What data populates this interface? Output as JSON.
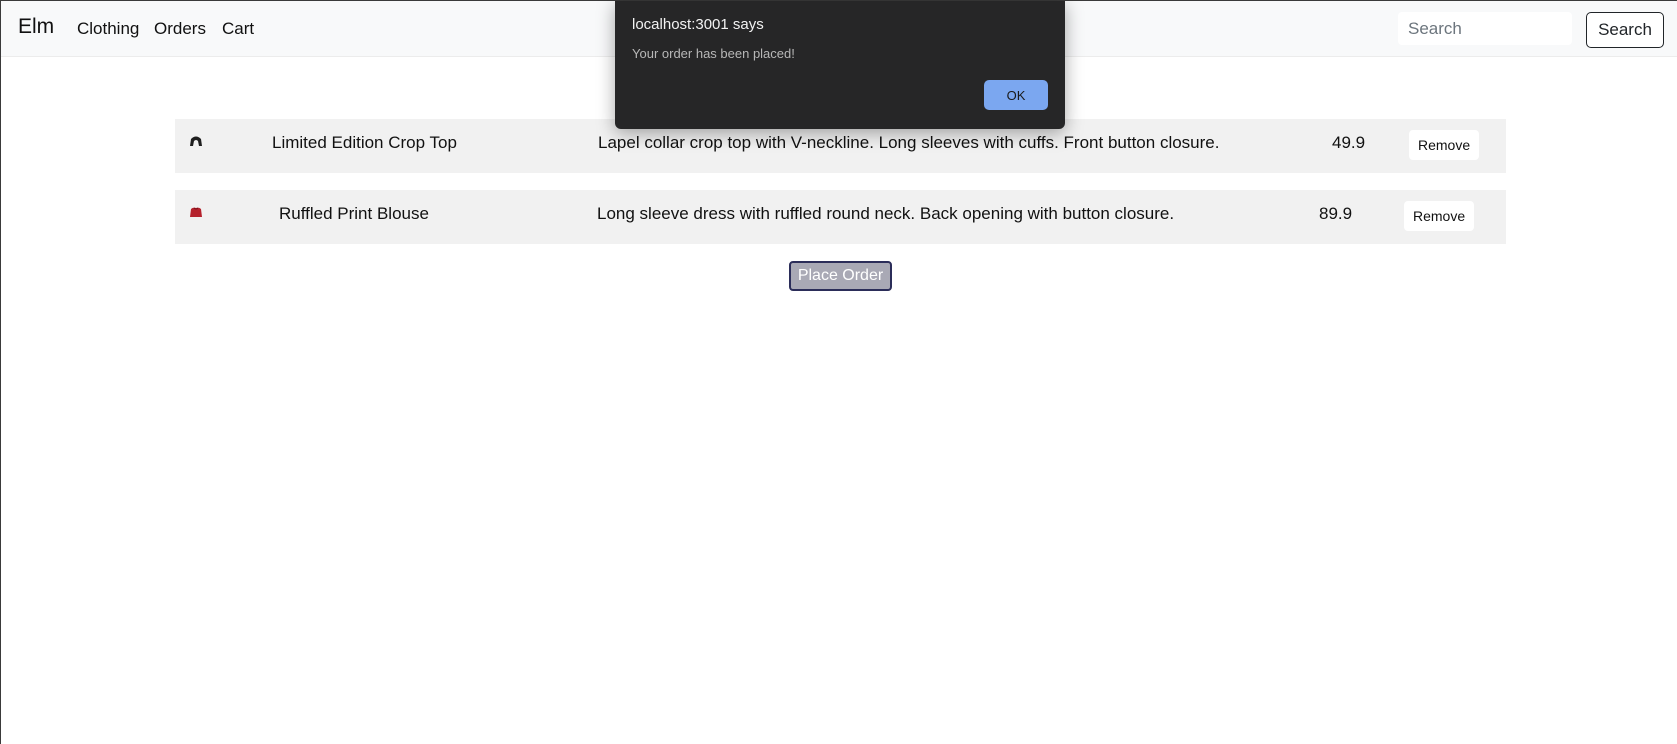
{
  "navbar": {
    "brand": "Elm",
    "links": [
      {
        "label": "Clothing"
      },
      {
        "label": "Orders"
      },
      {
        "label": "Cart"
      }
    ],
    "search": {
      "placeholder": "Search",
      "value": "",
      "button_label": "Search"
    }
  },
  "cart": {
    "items": [
      {
        "thumbnail_icon": "black-crop-top-icon",
        "thumbnail_color": "#1f1f1f",
        "name": "Limited Edition Crop Top",
        "description": "Lapel collar crop top with V-neckline. Long sleeves with cuffs. Front button closure.",
        "price": "49.9",
        "remove_label": "Remove"
      },
      {
        "thumbnail_icon": "red-blouse-icon",
        "thumbnail_color": "#b5222d",
        "name": "Ruffled Print Blouse",
        "description": "Long sleeve dress with ruffled round neck. Back opening with button closure.",
        "price": "89.9",
        "remove_label": "Remove"
      }
    ],
    "place_order_label": "Place Order"
  },
  "alert": {
    "title": "localhost:3001 says",
    "message": "Your order has been placed!",
    "ok_label": "OK",
    "ok_color": "#7ba7f0"
  }
}
